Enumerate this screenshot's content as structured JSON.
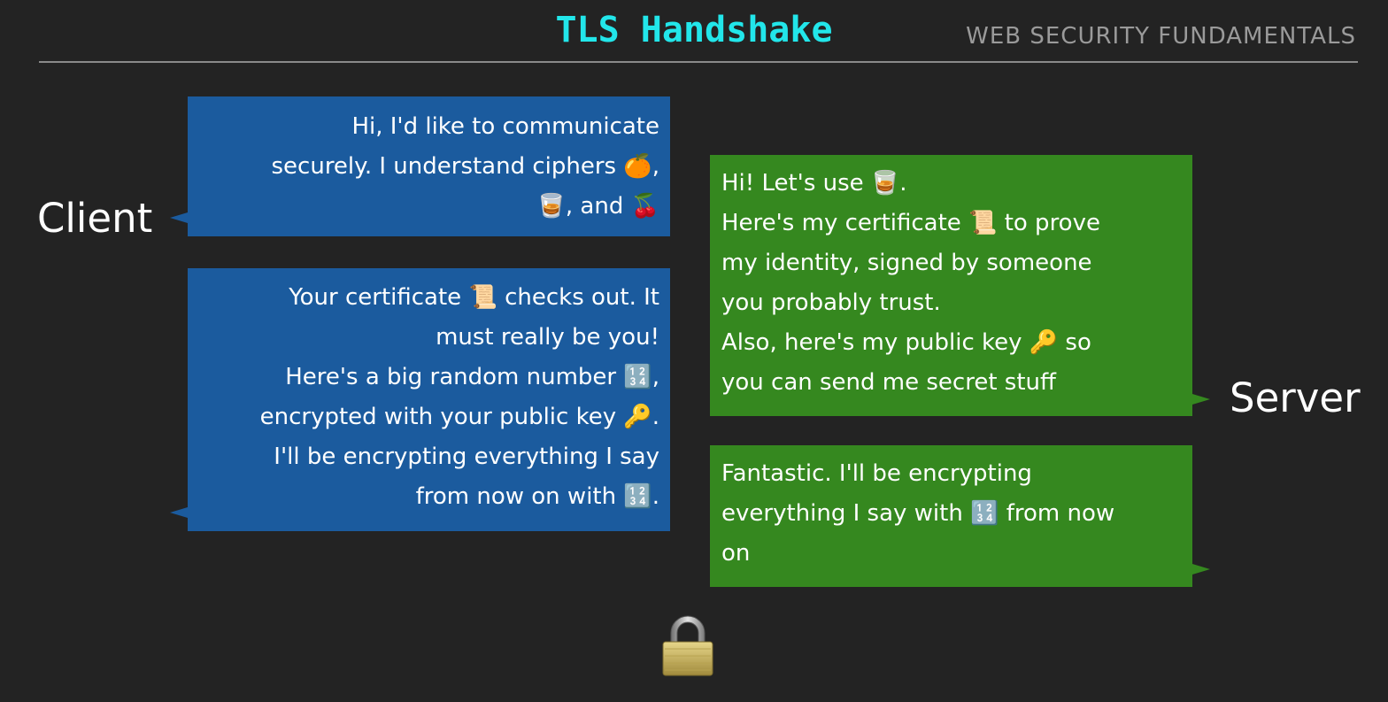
{
  "header": {
    "title": "TLS Handshake",
    "subtitle": "WEB SECURITY FUNDAMENTALS"
  },
  "labels": {
    "client": "Client",
    "server": "Server"
  },
  "messages": {
    "client_hello": [
      "Hi, I'd like to communicate",
      "securely. I understand ciphers 🍊,",
      "🥃, and 🍒"
    ],
    "server_hello": [
      "Hi! Let's use 🥃.",
      "Here's my certificate 📜 to prove",
      "my identity, signed by someone",
      "you probably trust.",
      "Also, here's my public key 🔑 so",
      "you can send me secret stuff"
    ],
    "client_key_exchange": [
      "Your certificate 📜 checks out. It",
      "must really be you!",
      "Here's a big random number 🔢,",
      "encrypted with your public key 🔑.",
      "I'll be encrypting everything I say",
      "from now on with 🔢."
    ],
    "server_finished": [
      "Fantastic. I'll be encrypting",
      "everything I say with 🔢 from now",
      "on"
    ]
  },
  "icons": {
    "lock": "lock-icon"
  },
  "colors": {
    "background": "#232323",
    "title": "#22e6ea",
    "client_bubble": "#1b5b9e",
    "server_bubble": "#35881f",
    "subtitle": "#9a9a9a"
  }
}
